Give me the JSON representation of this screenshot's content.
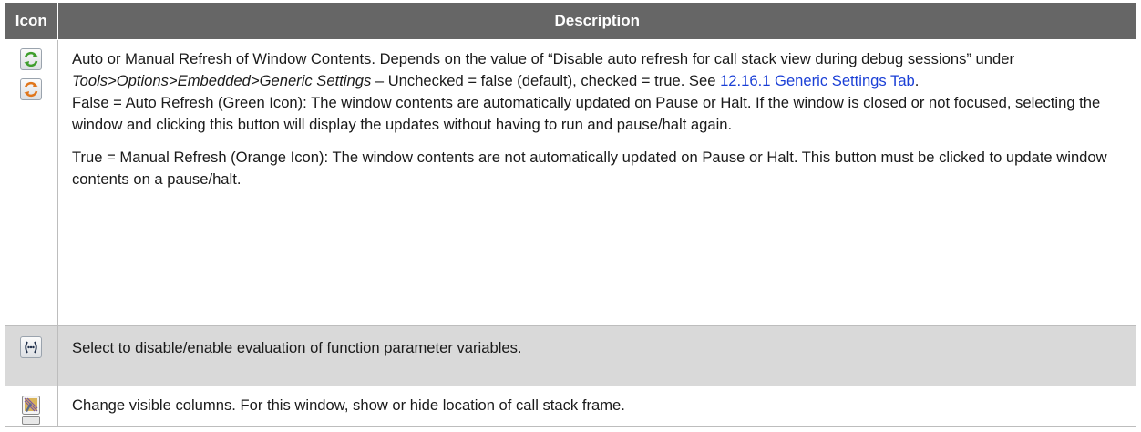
{
  "table": {
    "header_icon": "Icon",
    "header_description": "Description"
  },
  "rows": [
    {
      "icons": [
        "refresh-green-icon",
        "refresh-orange-icon"
      ],
      "p1_text_a": "Auto or Manual Refresh of Window Contents. Depends on the value of “Disable auto refresh for call stack view during debug sessions” under ",
      "p1_path": "Tools>Options>Embedded>Generic Settings",
      "p1_text_b": " – Unchecked = false (default), checked = true. See ",
      "p1_link": "12.16.1  Generic Settings Tab",
      "p1_text_c": ".",
      "p2": "False = Auto Refresh (Green Icon): The window contents are automatically updated on Pause or Halt. If the window is closed or not focused, selecting the window and clicking this button will display the updates without having to run and pause/halt again.",
      "p3": "True = Manual Refresh (Orange Icon): The window contents are not automatically updated on Pause or Halt. This button must be clicked to update window contents on a pause/halt."
    },
    {
      "icons": [
        "function-parameters-icon"
      ],
      "text": "Select to disable/enable evaluation of function parameter variables."
    },
    {
      "icons": [
        "columns-icon"
      ],
      "text": "Change visible columns. For this window, show or hide location of call stack frame."
    }
  ],
  "colors": {
    "header_bg": "#666666",
    "shaded_row_bg": "#d9d9d9",
    "link": "#1a3fd6",
    "refresh_green": "#3f9e2d",
    "refresh_orange": "#e0761b"
  }
}
